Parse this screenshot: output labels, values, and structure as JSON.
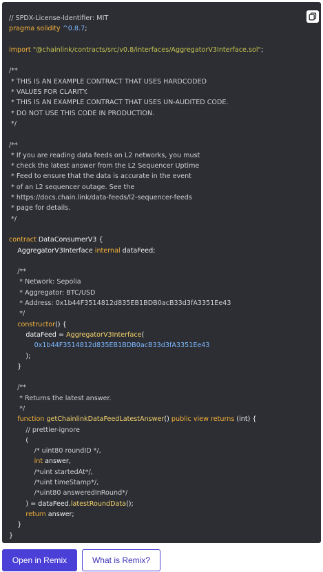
{
  "code": {
    "lines": [
      [
        {
          "t": "// SPDX-License-Identifier: MIT",
          "c": "comment"
        }
      ],
      [
        {
          "t": "pragma ",
          "c": "keyword"
        },
        {
          "t": "solidity ",
          "c": "keyword"
        },
        {
          "t": "^0.8.7",
          "c": "number"
        },
        {
          "t": ";",
          "c": "punct"
        }
      ],
      [],
      [
        {
          "t": "import ",
          "c": "keyword"
        },
        {
          "t": "\"@chainlink/contracts/src/v0.8/interfaces/AggregatorV3Interface.sol\"",
          "c": "string"
        },
        {
          "t": ";",
          "c": "punct"
        }
      ],
      [],
      [
        {
          "t": "/**",
          "c": "comment"
        }
      ],
      [
        {
          "t": " * THIS IS AN EXAMPLE CONTRACT THAT USES HARDCODED",
          "c": "comment"
        }
      ],
      [
        {
          "t": " * VALUES FOR CLARITY.",
          "c": "comment"
        }
      ],
      [
        {
          "t": " * THIS IS AN EXAMPLE CONTRACT THAT USES UN-AUDITED CODE.",
          "c": "comment"
        }
      ],
      [
        {
          "t": " * DO NOT USE THIS CODE IN PRODUCTION.",
          "c": "comment"
        }
      ],
      [
        {
          "t": " */",
          "c": "comment"
        }
      ],
      [],
      [
        {
          "t": "/**",
          "c": "comment"
        }
      ],
      [
        {
          "t": " * If you are reading data feeds on L2 networks, you must",
          "c": "comment"
        }
      ],
      [
        {
          "t": " * check the latest answer from the L2 Sequencer Uptime",
          "c": "comment"
        }
      ],
      [
        {
          "t": " * Feed to ensure that the data is accurate in the event",
          "c": "comment"
        }
      ],
      [
        {
          "t": " * of an L2 sequencer outage. See the",
          "c": "comment"
        }
      ],
      [
        {
          "t": " * https://docs.chain.link/data-feeds/l2-sequencer-feeds",
          "c": "comment"
        }
      ],
      [
        {
          "t": " * page for details.",
          "c": "comment"
        }
      ],
      [
        {
          "t": " */",
          "c": "comment"
        }
      ],
      [],
      [
        {
          "t": "contract ",
          "c": "keyword"
        },
        {
          "t": "DataConsumerV3 {",
          "c": "plain"
        }
      ],
      [
        {
          "t": "    AggregatorV3Interface ",
          "c": "type"
        },
        {
          "t": "internal ",
          "c": "keyword"
        },
        {
          "t": "dataFeed;",
          "c": "plain"
        }
      ],
      [],
      [
        {
          "t": "    /**",
          "c": "comment"
        }
      ],
      [
        {
          "t": "     * Network: Sepolia",
          "c": "comment"
        }
      ],
      [
        {
          "t": "     * Aggregator: BTC/USD",
          "c": "comment"
        }
      ],
      [
        {
          "t": "     * Address: 0x1b44F3514812d835EB1BDB0acB33d3fA3351Ee43",
          "c": "comment"
        }
      ],
      [
        {
          "t": "     */",
          "c": "comment"
        }
      ],
      [
        {
          "t": "    constructor",
          "c": "keyword"
        },
        {
          "t": "() {",
          "c": "punct"
        }
      ],
      [
        {
          "t": "        dataFeed = ",
          "c": "plain"
        },
        {
          "t": "AggregatorV3Interface",
          "c": "fn"
        },
        {
          "t": "(",
          "c": "punct"
        }
      ],
      [
        {
          "t": "            0x1b44F3514812d835EB1BDB0acB33d3fA3351Ee43",
          "c": "address"
        }
      ],
      [
        {
          "t": "        );",
          "c": "punct"
        }
      ],
      [
        {
          "t": "    }",
          "c": "punct"
        }
      ],
      [],
      [
        {
          "t": "    /**",
          "c": "comment"
        }
      ],
      [
        {
          "t": "     * Returns the latest answer.",
          "c": "comment"
        }
      ],
      [
        {
          "t": "     */",
          "c": "comment"
        }
      ],
      [
        {
          "t": "    function ",
          "c": "keyword"
        },
        {
          "t": "getChainlinkDataFeedLatestAnswer",
          "c": "fn"
        },
        {
          "t": "() ",
          "c": "punct"
        },
        {
          "t": "public ",
          "c": "keyword"
        },
        {
          "t": "view ",
          "c": "keyword"
        },
        {
          "t": "returns ",
          "c": "keyword"
        },
        {
          "t": "(int) {",
          "c": "punct"
        }
      ],
      [
        {
          "t": "        // prettier-ignore",
          "c": "comment"
        }
      ],
      [
        {
          "t": "        (",
          "c": "punct"
        }
      ],
      [
        {
          "t": "            /* uint80 roundID */,",
          "c": "comment"
        }
      ],
      [
        {
          "t": "            int ",
          "c": "keyword"
        },
        {
          "t": "answer,",
          "c": "plain"
        }
      ],
      [
        {
          "t": "            /*uint startedAt*/,",
          "c": "comment"
        }
      ],
      [
        {
          "t": "            /*uint timeStamp*/,",
          "c": "comment"
        }
      ],
      [
        {
          "t": "            /*uint80 answeredInRound*/",
          "c": "comment"
        }
      ],
      [
        {
          "t": "        ) = dataFeed.",
          "c": "plain"
        },
        {
          "t": "latestRoundData",
          "c": "fn"
        },
        {
          "t": "();",
          "c": "punct"
        }
      ],
      [
        {
          "t": "        return ",
          "c": "keyword"
        },
        {
          "t": "answer;",
          "c": "plain"
        }
      ],
      [
        {
          "t": "    }",
          "c": "punct"
        }
      ],
      [
        {
          "t": "}",
          "c": "punct"
        }
      ]
    ]
  },
  "copy_button": {
    "icon": "copy-icon"
  },
  "actions": {
    "open_in_remix": "Open in Remix",
    "what_is_remix": "What is Remix?"
  }
}
